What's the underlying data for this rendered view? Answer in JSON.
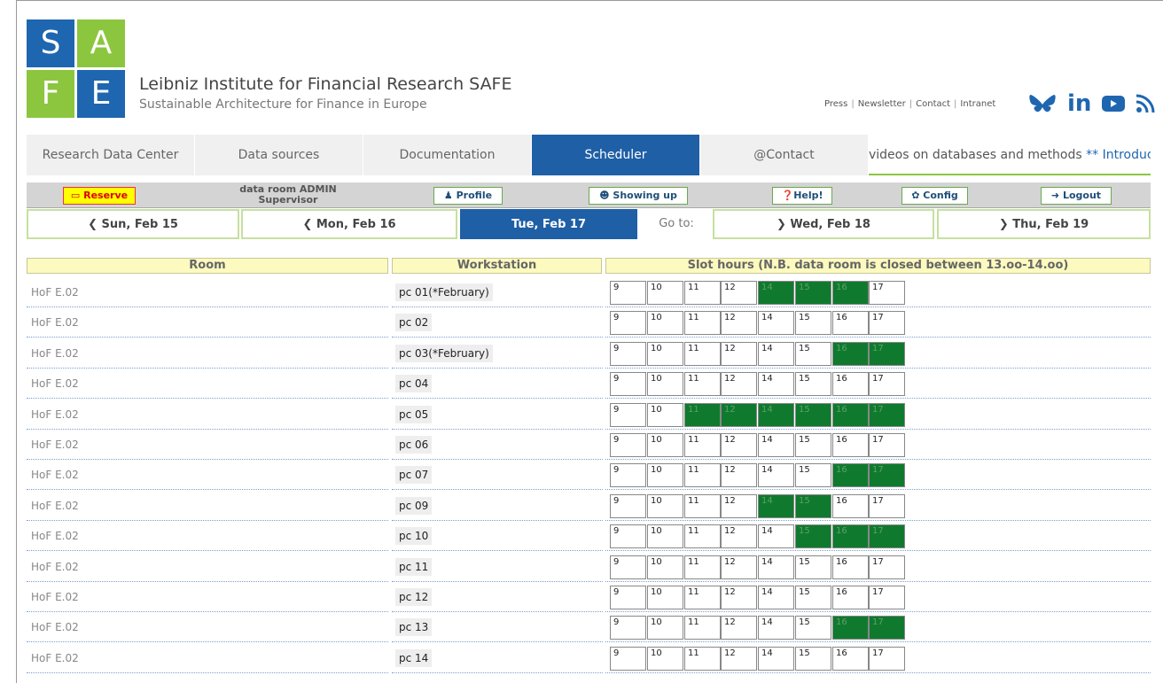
{
  "logo": {
    "letters": [
      "S",
      "A",
      "F",
      "E"
    ]
  },
  "header": {
    "title": "Leibniz Institute for Financial Research SAFE",
    "subtitle": "Sustainable Architecture for Finance in Europe",
    "links": [
      "Press",
      "Newsletter",
      "Contact",
      "Intranet"
    ],
    "social_icons": [
      "bluesky-icon",
      "linkedin-icon",
      "youtube-icon",
      "rss-icon"
    ]
  },
  "nav": {
    "items": [
      "Research Data Center",
      "Data sources",
      "Documentation",
      "Scheduler",
      "@Contact"
    ],
    "active": "Scheduler",
    "ticker_text": "videos on databases and methods ",
    "ticker_accent": "** Introduc"
  },
  "admin": {
    "reserve": "Reserve",
    "user_line1": "data room ADMIN",
    "user_line2": "Supervisor",
    "profile": "Profile",
    "showing_up": "Showing up",
    "help": "Help!",
    "config": "Config",
    "logout": "Logout"
  },
  "days": {
    "prev2": "Sun, Feb 15",
    "prev1": "Mon, Feb 16",
    "current": "Tue, Feb 17",
    "goto": "Go to:",
    "next1": "Wed, Feb 18",
    "next2": "Thu, Feb 19"
  },
  "table": {
    "headers": {
      "room": "Room",
      "workstation": "Workstation",
      "slots": "Slot hours (N.B. data room is closed between 13.oo-14.oo)"
    },
    "hours": [
      "9",
      "10",
      "11",
      "12",
      "14",
      "15",
      "16",
      "17"
    ],
    "rows": [
      {
        "room": "HoF E.02",
        "ws": "pc 01(*February)",
        "busy": [
          "14",
          "15",
          "16"
        ]
      },
      {
        "room": "HoF E.02",
        "ws": "pc 02",
        "busy": []
      },
      {
        "room": "HoF E.02",
        "ws": "pc 03(*February)",
        "busy": [
          "16",
          "17"
        ]
      },
      {
        "room": "HoF E.02",
        "ws": "pc 04",
        "busy": []
      },
      {
        "room": "HoF E.02",
        "ws": "pc 05",
        "busy": [
          "11",
          "12",
          "14",
          "15",
          "16",
          "17"
        ]
      },
      {
        "room": "HoF E.02",
        "ws": "pc 06",
        "busy": []
      },
      {
        "room": "HoF E.02",
        "ws": "pc 07",
        "busy": [
          "16",
          "17"
        ]
      },
      {
        "room": "HoF E.02",
        "ws": "pc 09",
        "busy": [
          "14",
          "15"
        ]
      },
      {
        "room": "HoF E.02",
        "ws": "pc 10",
        "busy": [
          "15",
          "16",
          "17"
        ]
      },
      {
        "room": "HoF E.02",
        "ws": "pc 11",
        "busy": []
      },
      {
        "room": "HoF E.02",
        "ws": "pc 12",
        "busy": []
      },
      {
        "room": "HoF E.02",
        "ws": "pc 13",
        "busy": [
          "16",
          "17"
        ]
      },
      {
        "room": "HoF E.02",
        "ws": "pc 14",
        "busy": []
      }
    ]
  }
}
